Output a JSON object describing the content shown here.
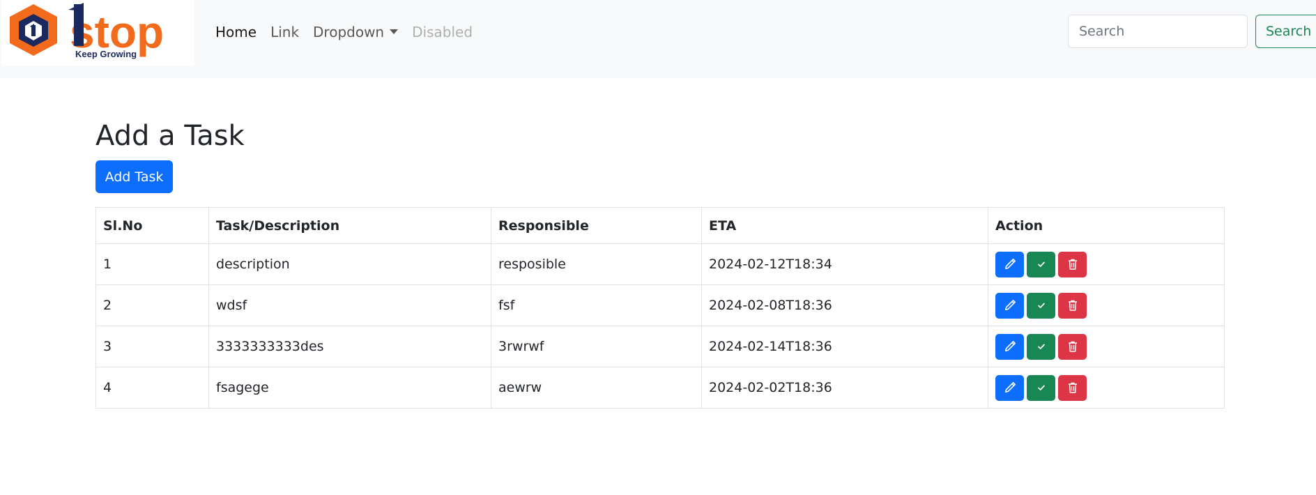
{
  "navbar": {
    "brand": {
      "logo_text": "1stop",
      "tagline": "Keep Growing",
      "colors": {
        "orange": "#f26b1d",
        "navy": "#1b2a5e"
      }
    },
    "links": [
      {
        "label": "Home",
        "state": "active"
      },
      {
        "label": "Link",
        "state": "normal"
      },
      {
        "label": "Dropdown",
        "state": "normal"
      },
      {
        "label": "Disabled",
        "state": "disabled"
      }
    ],
    "search": {
      "placeholder": "Search",
      "button_label": "Search"
    }
  },
  "main": {
    "title": "Add a Task",
    "add_button_label": "Add Task",
    "table": {
      "headers": [
        "Sl.No",
        "Task/Description",
        "Responsible",
        "ETA",
        "Action"
      ],
      "rows": [
        {
          "sl": "1",
          "task": "description",
          "responsible": "resposible",
          "eta": "2024-02-12T18:34"
        },
        {
          "sl": "2",
          "task": "wdsf",
          "responsible": "fsf",
          "eta": "2024-02-08T18:36"
        },
        {
          "sl": "3",
          "task": "3333333333des",
          "responsible": "3rwrwf",
          "eta": "2024-02-14T18:36"
        },
        {
          "sl": "4",
          "task": "fsagege",
          "responsible": "aewrw",
          "eta": "2024-02-02T18:36"
        }
      ],
      "actions": [
        {
          "icon": "pencil-icon",
          "color": "#0d6efd"
        },
        {
          "icon": "check-icon",
          "color": "#198754"
        },
        {
          "icon": "trash-icon",
          "color": "#dc3545"
        }
      ]
    }
  }
}
